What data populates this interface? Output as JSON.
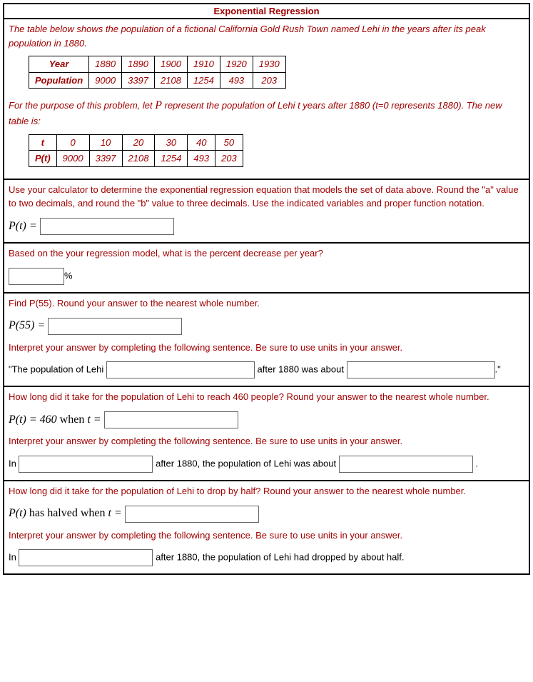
{
  "title": "Exponential Regression",
  "intro_part1": "The table below shows the population of a fictional California Gold Rush Town named Lehi in the years after its peak population in 1880.",
  "table1": {
    "h_year": "Year",
    "h_pop": "Population",
    "years": [
      "1880",
      "1890",
      "1900",
      "1910",
      "1920",
      "1930"
    ],
    "pops": [
      "9000",
      "3397",
      "2108",
      "1254",
      "493",
      "203"
    ]
  },
  "intro_part2a": "For the purpose of this problem, let ",
  "intro_part2b": " represent the population of Lehi t years after 1880 (t=0 represents 1880). The new table is:",
  "P_var": "P",
  "table2": {
    "h_t": "t",
    "h_pt": "P(t)",
    "ts": [
      "0",
      "10",
      "20",
      "30",
      "40",
      "50"
    ],
    "pts": [
      "9000",
      "3397",
      "2108",
      "1254",
      "493",
      "203"
    ]
  },
  "q1": "Use your calculator to determine the exponential regression equation that models the set of data above. Round the \"a\" value to two decimals, and round the \"b\" value to three decimals. Use the indicated variables and proper function notation.",
  "pt_eq": "P(t) = ",
  "q2": "Based on the your regression model, what is the percent decrease per year?",
  "pct": "%",
  "q3": "Find P(55). Round your answer to the nearest whole number.",
  "p55": "P(55) = ",
  "q3b": "Interpret your answer by completing the following sentence. Be sure to use units in your answer.",
  "s3a": "\"The population of Lehi ",
  "s3b": " after 1880 was about ",
  "s3c": ".\"",
  "q4": "How long did it take for the population of Lehi to reach 460 people? Round your answer to the nearest whole number.",
  "pt460a": "P(t) = 460",
  "pt460b": " when ",
  "pt460c": "t = ",
  "q4b": "Interpret your answer by completing the following sentence. Be sure to use units in your answer.",
  "s4a": "In ",
  "s4b": " after 1880, the population of Lehi was about ",
  "s4c": ".",
  "q5": "How long did it take for the population of Lehi to drop by half? Round your answer to the nearest whole number.",
  "pthalf_a": "P(t)",
  "pthalf_b": " has halved when ",
  "pthalf_c": "t = ",
  "q5b": "Interpret your answer by completing the following sentence. Be sure to use units in your answer.",
  "s5a": "In ",
  "s5b": " after 1880, the population of Lehi had dropped by about half."
}
